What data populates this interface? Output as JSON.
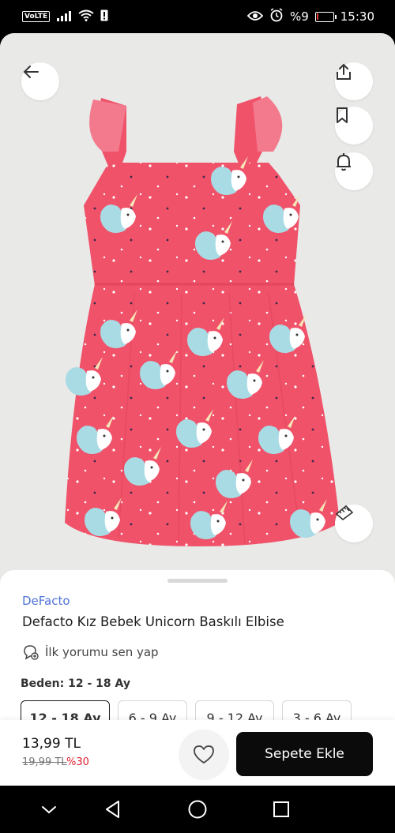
{
  "status_bar": {
    "volte": "VoLTE",
    "battery_percent": "%9",
    "battery_level": 0.09,
    "time": "15:30",
    "icons": [
      "signal-icon",
      "wifi-icon",
      "sim-alert-icon",
      "eye-icon",
      "alarm-icon",
      "battery-icon"
    ]
  },
  "product": {
    "brand": "DeFacto",
    "title": "Defacto Kız Bebek Unicorn Baskılı Elbise",
    "review_prompt": "İlk yorumu sen yap",
    "size_label": "Beden: 12 - 18 Ay",
    "sizes": [
      "12 - 18 Ay",
      "6 - 9 Ay",
      "9 - 12 Ay",
      "3 - 6 Ay"
    ],
    "selected_size": "12 - 18 Ay",
    "image_colors": {
      "dress": "#f0526a",
      "background": "#e9e9e7",
      "print": "#a8dbe4"
    }
  },
  "purchase": {
    "price": "13,99 TL",
    "old_price": "19,99 TL",
    "discount": "%30",
    "add_to_cart": "Sepete Ekle"
  },
  "icons": {
    "back": "arrow-left-icon",
    "share": "share-icon",
    "favorite": "bookmark-icon",
    "notify": "bell-icon",
    "size_guide": "ruler-icon",
    "wishlist": "heart-icon"
  },
  "colors": {
    "accent": "#4f74d8",
    "discount": "#e0202f",
    "cta": "#0b0b0b"
  }
}
